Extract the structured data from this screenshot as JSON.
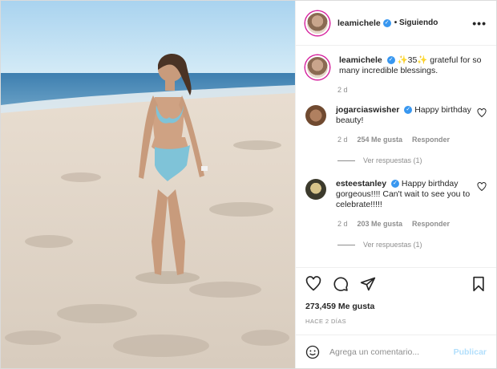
{
  "header": {
    "username": "leamichele",
    "follow_status": "Siguiendo",
    "more_icon": "more-icon"
  },
  "caption": {
    "username": "leamichele",
    "text": "✨35✨ grateful for so many incredible blessings.",
    "time": "2 d"
  },
  "comments": [
    {
      "username": "jogarciaswisher",
      "text": "Happy birthday beauty!",
      "time": "2 d",
      "likes": "254 Me gusta",
      "reply": "Responder",
      "view_replies": "Ver respuestas (1)"
    },
    {
      "username": "esteestanley",
      "text": "Happy birthday gorgeous!!!! Can't wait to see you to celebrate!!!!!",
      "time": "2 d",
      "likes": "203 Me gusta",
      "reply": "Responder",
      "view_replies": "Ver respuestas (1)"
    }
  ],
  "actions": {
    "likes": "273,459 Me gusta",
    "posted_ago": "HACE 2 DÍAS"
  },
  "add_comment": {
    "placeholder": "Agrega un comentario...",
    "publish": "Publicar"
  },
  "colors": {
    "verified": "#3897f0",
    "publish": "#b2dffc",
    "ring": "#d6249f"
  }
}
